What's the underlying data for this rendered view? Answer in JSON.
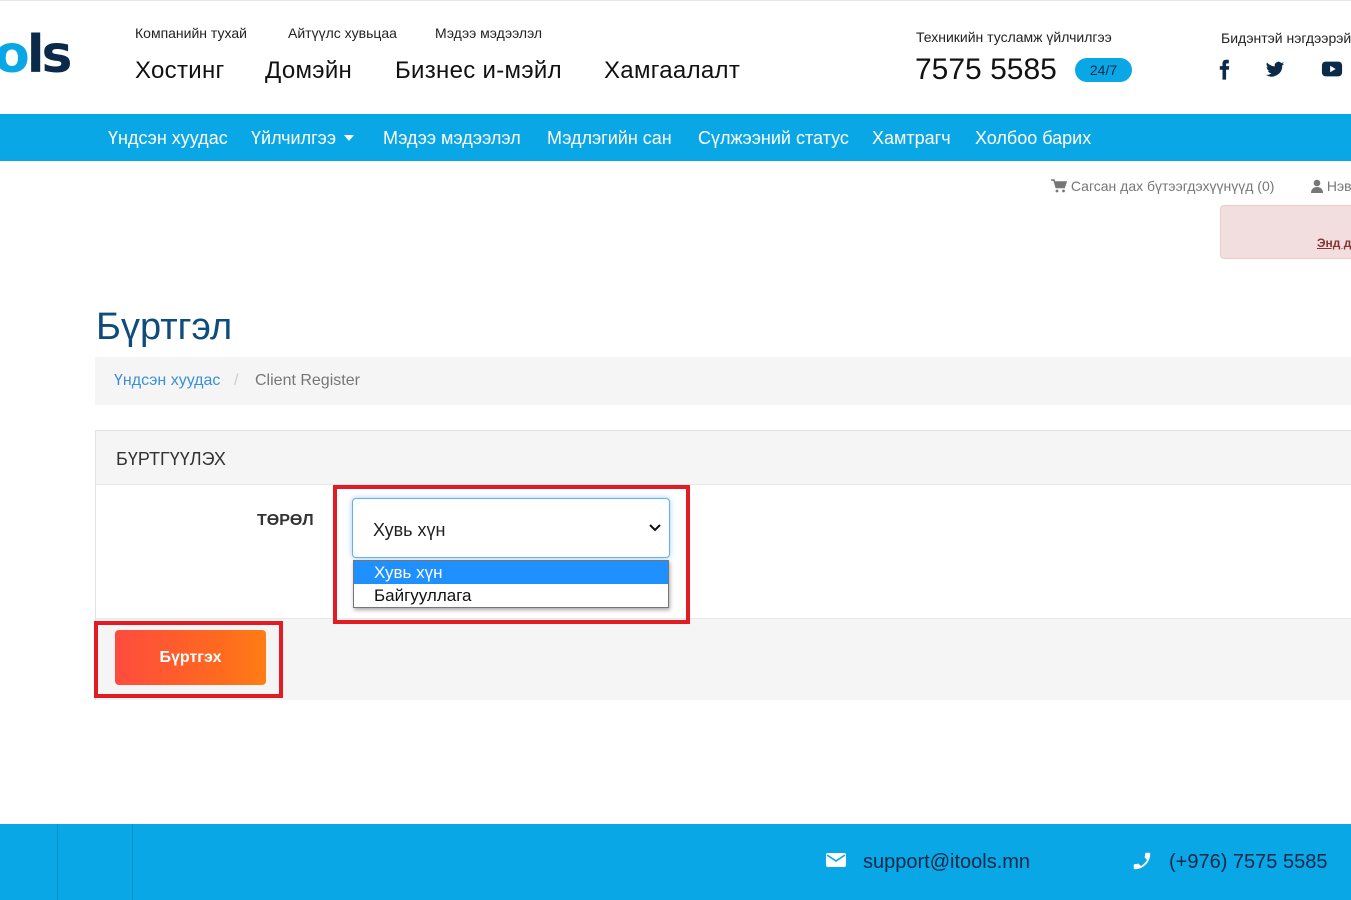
{
  "header": {
    "logo_text": "ols",
    "top_links": [
      "Компанийн тухай",
      "Айтүүлс хувьцаа",
      "Мэдээ мэдээлэл"
    ],
    "main_links": [
      "Хостинг",
      "Домэйн",
      "Бизнес и-мэйл",
      "Хамгаалалт"
    ],
    "support_label": "Техникийн тусламж үйлчилгээ",
    "support_phone": "7575 5585",
    "support_badge": "24/7",
    "contact_label": "Бидэнтэй нэгдээрэй",
    "social_icons": [
      "facebook-icon",
      "twitter-icon",
      "youtube-icon"
    ]
  },
  "nav": {
    "items": [
      "Үндсэн хуудас",
      "Үйлчилгээ",
      "Мэдээ мэдээлэл",
      "Мэдлэгийн сан",
      "Сүлжээний статус",
      "Хамтрагч",
      "Холбоо барих"
    ]
  },
  "cart": {
    "label": "Сагсан дах бүтээгдэхүүнүүд (0)",
    "user_label": "Нэвтрэх"
  },
  "alert": {
    "link": "Энд дарна уу"
  },
  "page": {
    "title": "Бүртгэл",
    "breadcrumb": {
      "home": "Үндсэн хуудас",
      "separator": "/",
      "current": "Client Register"
    }
  },
  "form": {
    "panel_title": "БҮРТГҮҮЛЭХ",
    "type_label": "ТӨРӨЛ",
    "type_value": "Хувь хүн",
    "options": [
      "Хувь хүн",
      "Байгууллага"
    ],
    "submit_label": "Бүртгэх"
  },
  "footer": {
    "email": "support@itools.mn",
    "phone": "(+976) 7575 5585"
  },
  "colors": {
    "brand_blue": "#0aa7e6",
    "title_blue": "#0e4c7b",
    "button_gradient_start": "#ff4b3e",
    "button_gradient_end": "#ff7d15",
    "highlight_red": "#e31b23",
    "option_selected": "#1e90ff"
  }
}
